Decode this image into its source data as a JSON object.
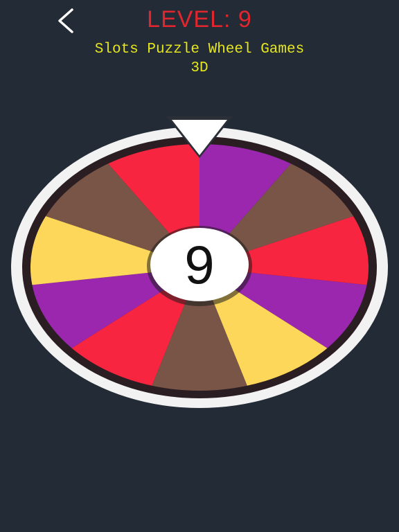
{
  "header": {
    "level_text": "LEVEL: 9",
    "app_title": "Slots Puzzle Wheel Games\n3D",
    "back_icon": "chevron-left-icon"
  },
  "wheel": {
    "center_number": "9",
    "pointer_icon": "triangle-down-icon",
    "segments": [
      "purple",
      "brown",
      "red",
      "purple",
      "yellow",
      "brown",
      "red",
      "purple",
      "yellow",
      "brown",
      "red"
    ]
  },
  "colors": {
    "background": "#222b36",
    "level_text": "#e0262e",
    "app_title": "#e6e61e",
    "rim": "#f2f2f2",
    "center_disc": "#ffffff",
    "center_text": "#111111",
    "red": "#f7253f",
    "purple": "#9b27af",
    "brown": "#795548",
    "yellow": "#fcd75a"
  }
}
